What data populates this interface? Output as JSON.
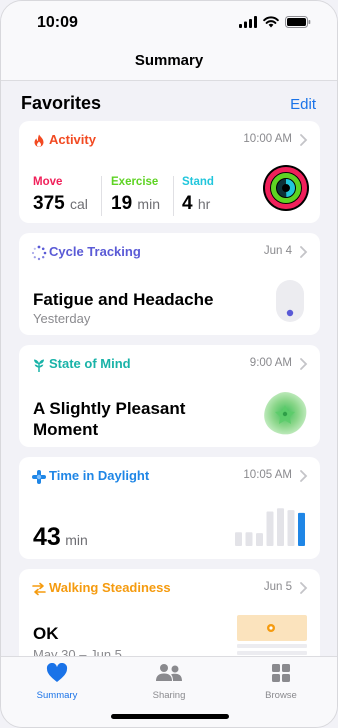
{
  "status_bar": {
    "time": "10:09"
  },
  "nav": {
    "title": "Summary"
  },
  "favorites": {
    "title": "Favorites",
    "edit_label": "Edit"
  },
  "colors": {
    "activity": "#f24a22",
    "move": "#f0205a",
    "exercise": "#5ed323",
    "stand": "#21c6dc",
    "cycle": "#5a5ad6",
    "mind": "#19b3a8",
    "daylight": "#1f86e6",
    "steadiness": "#f59b0f",
    "tab_active": "#1a73e8",
    "tab_inactive": "#8a8a8e"
  },
  "cards": {
    "activity": {
      "label": "Activity",
      "meta": "10:00 AM",
      "icon": "flame-icon",
      "metrics": [
        {
          "label": "Move",
          "value": "375",
          "unit": "cal"
        },
        {
          "label": "Exercise",
          "value": "19",
          "unit": "min"
        },
        {
          "label": "Stand",
          "value": "4",
          "unit": "hr"
        }
      ]
    },
    "cycle": {
      "label": "Cycle Tracking",
      "meta": "Jun 4",
      "icon": "cycle-dots-icon",
      "title": "Fatigue and Headache",
      "subtitle": "Yesterday"
    },
    "mind": {
      "label": "State of Mind",
      "meta": "9:00 AM",
      "icon": "mind-plant-icon",
      "title_line1": "A Slightly Pleasant",
      "title_line2": "Moment"
    },
    "daylight": {
      "label": "Time in Daylight",
      "meta": "10:05 AM",
      "icon": "sun-icon",
      "value": "43",
      "unit": "min",
      "bars": [
        0.3,
        0.3,
        0.28,
        0.75,
        0.82,
        0.78,
        0.72
      ]
    },
    "steadiness": {
      "label": "Walking Steadiness",
      "meta": "Jun 5",
      "icon": "steadiness-icon",
      "title": "OK",
      "subtitle": "May 30 – Jun 5"
    }
  },
  "tabs": [
    {
      "label": "Summary",
      "icon": "heart-icon",
      "active": true
    },
    {
      "label": "Sharing",
      "icon": "people-icon",
      "active": false
    },
    {
      "label": "Browse",
      "icon": "grid-icon",
      "active": false
    }
  ]
}
